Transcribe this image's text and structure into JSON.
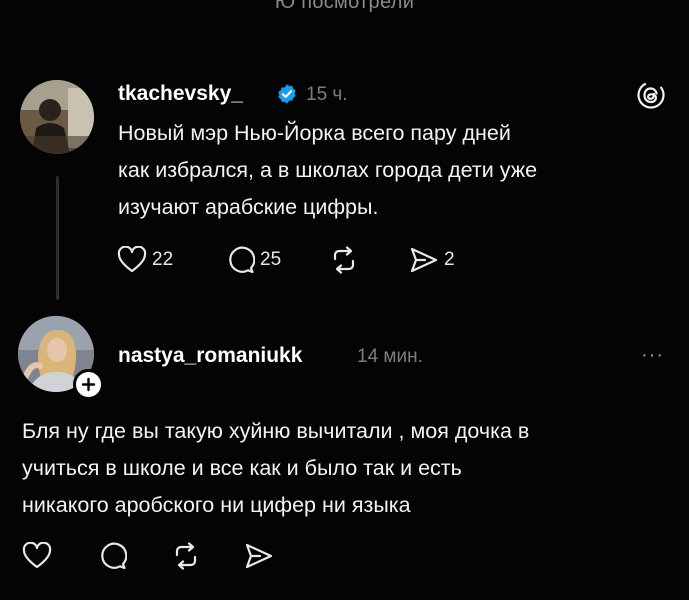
{
  "header": {
    "views_text": "Ю посмотрели"
  },
  "post": {
    "username": "tkachevsky_",
    "time": "15 ч.",
    "lines": [
      "Новый мэр Нью-Йорка всего пару дней",
      "как избрался, а в школах города дети уже",
      "изучают арабские цифры."
    ],
    "likes": "22",
    "replies": "25",
    "reposts": "",
    "shares": "2"
  },
  "reply": {
    "username": "nastya_romaniukk",
    "time": "14 мин.",
    "more": "···",
    "lines": [
      "Бля ну где вы такую хуйню вычитали , моя дочка в",
      "учиться в школе и все как и было так и есть",
      "никакого аробского ни цифер ни языка"
    ]
  },
  "icons": {
    "verified": "verified-icon",
    "threads_logo": "threads-logo-icon",
    "like": "heart-icon",
    "reply": "comment-icon",
    "repost": "repost-icon",
    "share": "send-icon",
    "follow": "plus-icon"
  },
  "colors": {
    "background": "#040404",
    "verified": "#1d9bf0",
    "muted": "#7d7d7d"
  }
}
